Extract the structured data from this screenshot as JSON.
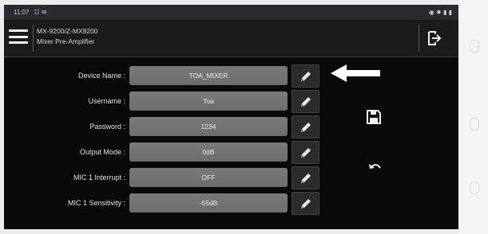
{
  "statusbar": {
    "time": "11:07",
    "left_icons": "☷ ✉",
    "right_icons": "◉ ✸ ▮ ▮"
  },
  "header": {
    "title_line1": "MX-9200/Z-MX9200",
    "title_line2": "Mixer Pre-Amplifier"
  },
  "settings": [
    {
      "label": "Device Name :",
      "value": "TOA_MIXER"
    },
    {
      "label": "Username :",
      "value": "Toa"
    },
    {
      "label": "Password :",
      "value": "1234"
    },
    {
      "label": "Output Mode :",
      "value": "0dB"
    },
    {
      "label": "MIC 1 Interrupt :",
      "value": "OFF"
    },
    {
      "label": "MIC 1 Sensitivity :",
      "value": "-55dB"
    }
  ],
  "icons": {
    "menu": "menu-icon",
    "exit": "exit-icon",
    "edit": "pencil-icon",
    "save": "save-icon",
    "undo": "undo-icon",
    "annotation": "arrow-left-icon"
  },
  "colors": {
    "screen_bg": "#0b0b0b",
    "field_bg": "#737373",
    "annotation_arrow": "#ffffff"
  }
}
